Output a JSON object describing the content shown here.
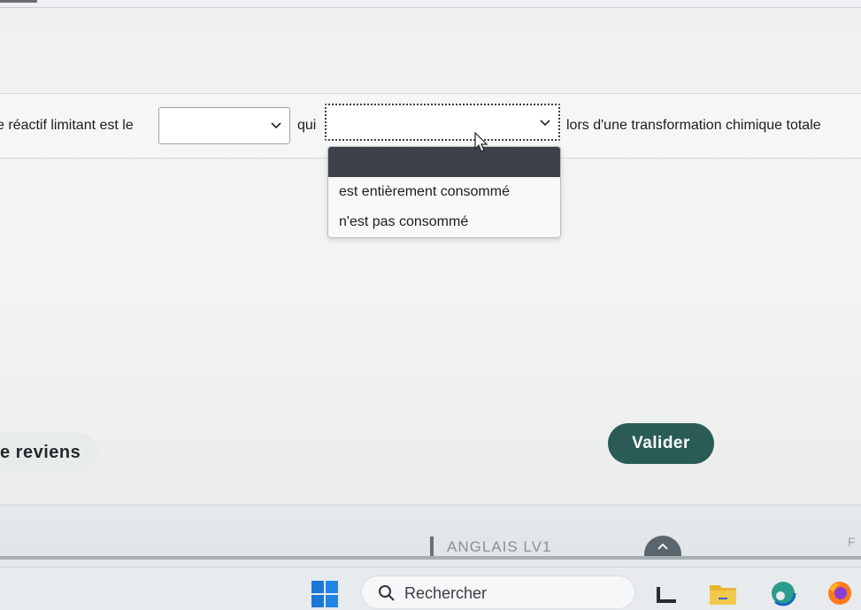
{
  "question": {
    "part1": "e réactif limitant est le",
    "part2": "qui",
    "part3": "lors d'une transformation chimique totale",
    "select1": {
      "value": ""
    },
    "select2": {
      "value": ""
    }
  },
  "dropdown": {
    "options": [
      "est entièrement consommé",
      "n'est pas consommé"
    ]
  },
  "buttons": {
    "back_label": "e reviens",
    "validate_label": "Valider"
  },
  "footer": {
    "course_label": "ANGLAIS LV1",
    "edge_letter": "F"
  },
  "taskbar": {
    "search_placeholder": "Rechercher"
  },
  "colors": {
    "validate_button": "#2a5c55",
    "dropdown_header": "#3d4248"
  }
}
